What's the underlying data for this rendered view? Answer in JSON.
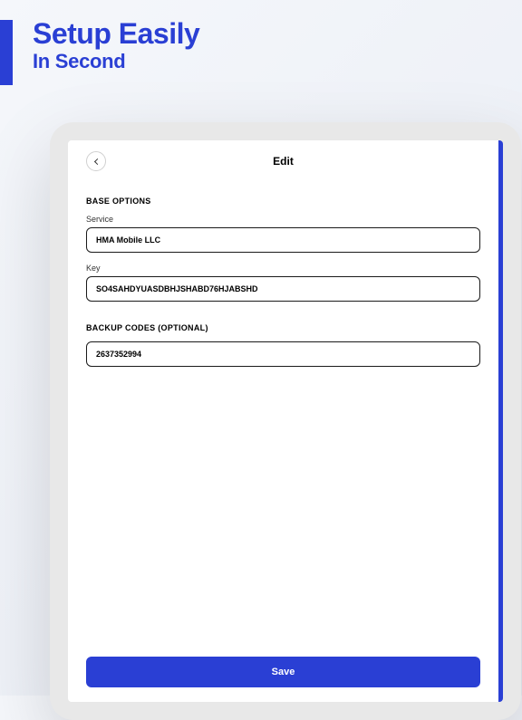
{
  "promo": {
    "title": "Setup Easily",
    "subtitle": "In Second"
  },
  "screen": {
    "title": "Edit",
    "sections": {
      "base": {
        "heading": "BASE OPTIONS",
        "service": {
          "label": "Service",
          "value": "HMA Mobile LLC"
        },
        "key": {
          "label": "Key",
          "value": "SO4SAHDYUASDBHJSHABD76HJABSHD"
        }
      },
      "backup": {
        "heading": "BACKUP CODES (OPTIONAL)",
        "code": {
          "value": "2637352994"
        }
      }
    },
    "save_label": "Save"
  }
}
